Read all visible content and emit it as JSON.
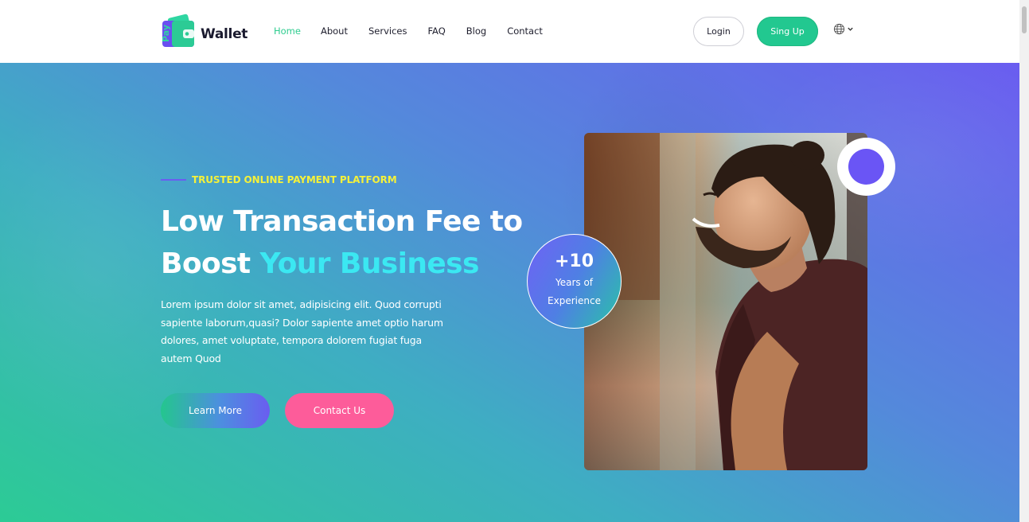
{
  "header": {
    "logo_text": "Wallet",
    "logo_badge": "Pay",
    "nav": [
      "Home",
      "About",
      "Services",
      "FAQ",
      "Blog",
      "Contact"
    ],
    "active_nav": "Home",
    "login_label": "Login",
    "signup_label": "Sing Up",
    "language_icon": "globe-icon"
  },
  "hero": {
    "eyebrow": "TRUSTED ONLINE PAYMENT PLATFORM",
    "headline_line1": "Low Transaction Fee to",
    "headline_line2_plain": "Boost ",
    "headline_line2_accent": "Your Business",
    "description": "Lorem ipsum dolor sit amet, adipisicing elit. Quod corrupti sapiente laborum,quasi? Dolor sapiente amet optio harum dolores, amet voluptate, tempora dolorem fugiat fuga autem Quod",
    "learn_more_label": "Learn More",
    "contact_label": "Contact Us",
    "badge_number": "+10",
    "badge_line1": "Years of",
    "badge_line2": "Experience"
  },
  "colors": {
    "accent_green": "#22c890",
    "accent_purple": "#6a5df0",
    "accent_pink": "#fd5c9a",
    "eyebrow_yellow": "#f4f13a",
    "headline_accent": "#3be8f2"
  }
}
